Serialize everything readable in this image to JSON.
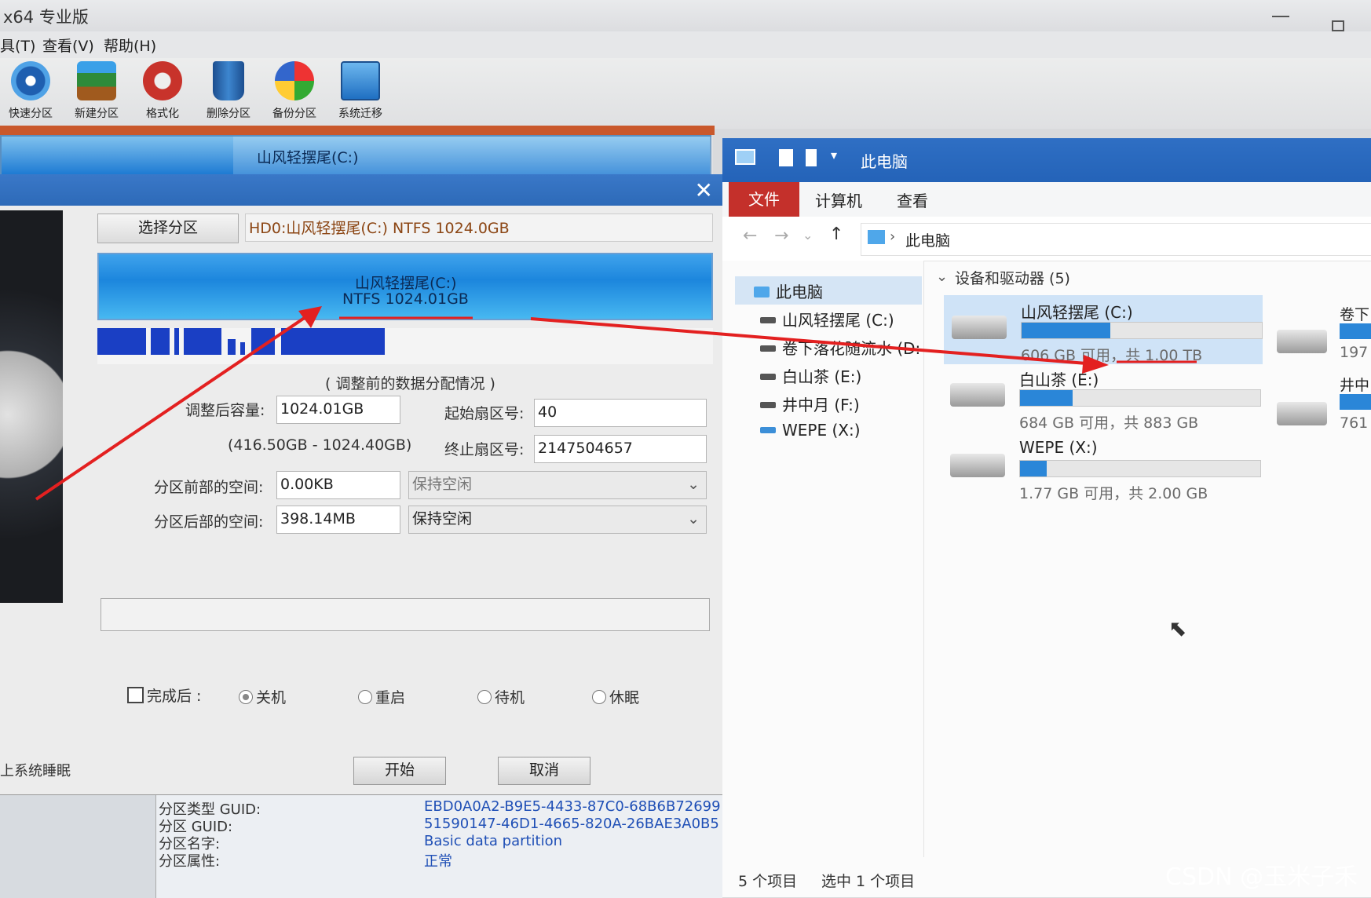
{
  "window": {
    "title": "x64 专业版"
  },
  "menu": [
    "具(T)",
    "查看(V)",
    "帮助(H)"
  ],
  "toolbar": [
    "快速分区",
    "新建分区",
    "格式化",
    "删除分区",
    "备份分区",
    "系统迁移"
  ],
  "top_partition": {
    "label": "山风轻摆尾(C:)"
  },
  "dialog": {
    "select_button": "选择分区",
    "selected_partition": "HD0:山风轻摆尾(C:) NTFS 1024.0GB",
    "bar_label1": "山风轻摆尾(C:)",
    "bar_label2": "NTFS 1024.01GB",
    "map_caption": "( 调整前的数据分配情况 )",
    "size_label": "调整后容量:",
    "size_value": "1024.01GB",
    "size_range": "(416.50GB - 1024.40GB)",
    "start_sector_label": "起始扇区号:",
    "start_sector_value": "40",
    "end_sector_label": "终止扇区号:",
    "end_sector_value": "2147504657",
    "before_label": "分区前部的空间:",
    "before_value": "0.00KB",
    "before_option": "保持空闲",
    "after_label": "分区后部的空间:",
    "after_value": "398.14MB",
    "after_option": "保持空闲",
    "complete_label": "完成后 :",
    "opt_shutdown": "关机",
    "opt_restart": "重启",
    "opt_standby": "待机",
    "opt_hibernate": "休眠",
    "sleep_note": "上系统睡眠",
    "start_button": "开始",
    "cancel_button": "取消"
  },
  "props": [
    {
      "key": "分区类型 GUID:",
      "value": "EBD0A0A2-B9E5-4433-87C0-68B6B72699"
    },
    {
      "key": "分区 GUID:",
      "value": "51590147-46D1-4665-820A-26BAE3A0B5"
    },
    {
      "key": "分区名字:",
      "value": "Basic data partition"
    },
    {
      "key": "分区属性:",
      "value": "正常"
    }
  ],
  "explorer": {
    "title": "此电脑",
    "tabs": [
      "文件",
      "计算机",
      "查看"
    ],
    "address": "此电脑",
    "group_header": "设备和驱动器 (5)",
    "nav": [
      "此电脑",
      "山风轻摆尾 (C:)",
      "卷下落花随流水 (D:",
      "白山茶 (E:)",
      "井中月 (F:)",
      "WEPE (X:)"
    ],
    "drives": [
      {
        "name": "山风轻摆尾 (C:)",
        "caption": "606 GB 可用，共 1.00 TB",
        "used_fraction": 0.37
      },
      {
        "name": "白山茶 (E:)",
        "caption": "684 GB 可用，共 883 GB",
        "used_fraction": 0.22
      },
      {
        "name": "WEPE (X:)",
        "caption": "1.77 GB 可用，共 2.00 GB",
        "used_fraction": 0.11
      }
    ],
    "right_col": [
      {
        "name": "卷下",
        "cap": "197"
      },
      {
        "name": "井中",
        "cap": "761"
      }
    ],
    "status_count": "5 个项目",
    "status_selected": "选中 1 个项目"
  },
  "watermark": "CSDN @玉米子禾",
  "colors": {
    "accent_blue": "#2463b8",
    "file_tab_red": "#c4302b",
    "annotation_red": "#e32020"
  }
}
